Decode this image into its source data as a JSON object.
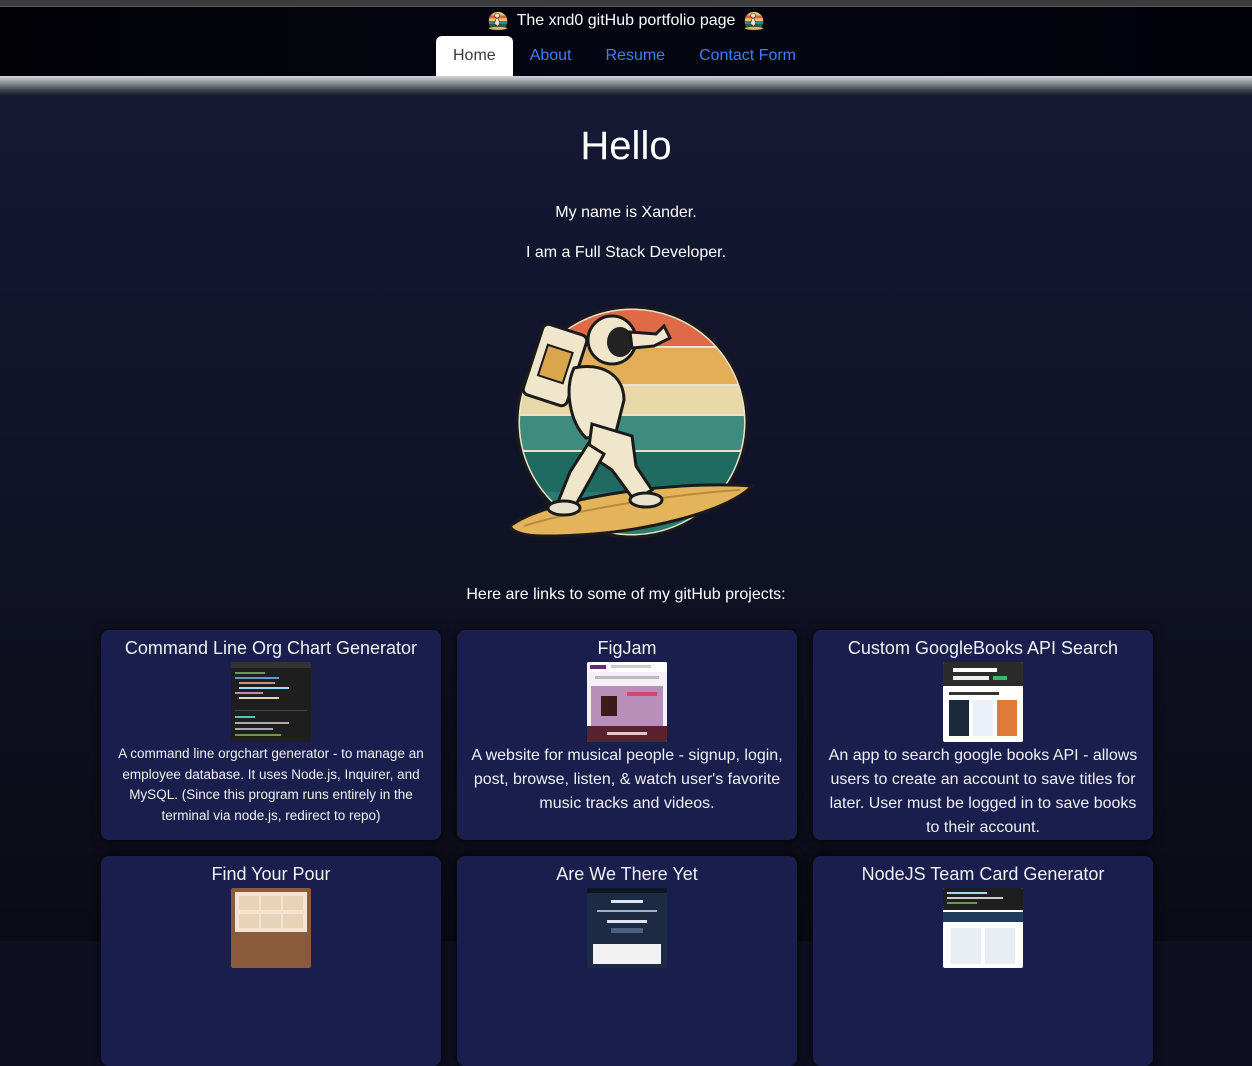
{
  "header": {
    "title": "The xnd0 gitHub portfolio page",
    "logo_icon": "astronaut-surfer-logo"
  },
  "nav": {
    "items": [
      {
        "label": "Home",
        "active": true
      },
      {
        "label": "About",
        "active": false
      },
      {
        "label": "Resume",
        "active": false
      },
      {
        "label": "Contact Form",
        "active": false
      }
    ]
  },
  "main": {
    "heading": "Hello",
    "intro_name": "My name is Xander.",
    "intro_role": "I am a Full Stack Developer.",
    "hero_image": "astronaut-surfer-illustration",
    "projects_intro": "Here are links to some of my gitHub projects:"
  },
  "projects": [
    {
      "title": "Command Line Org Chart Generator",
      "description": "A command line orgchart generator - to manage an employee database. It uses Node.js, Inquirer, and MySQL. (Since this program runs entirely in the terminal via node.js, redirect to repo)"
    },
    {
      "title": "FigJam",
      "description": "A website for musical people - signup, login, post, browse, listen, & watch user's favorite music tracks and videos."
    },
    {
      "title": "Custom GoogleBooks API Search",
      "description": "An app to search google books API - allows users to create an account to save titles for later. User must be logged in to save books to their account."
    },
    {
      "title": "Find Your Pour",
      "description": ""
    },
    {
      "title": "Are We There Yet",
      "description": ""
    },
    {
      "title": "NodeJS Team Card Generator",
      "description": ""
    }
  ],
  "colors": {
    "nav_link": "#3d7dff",
    "card_bg": "#1a1e4d",
    "page_bg": "#101327"
  }
}
